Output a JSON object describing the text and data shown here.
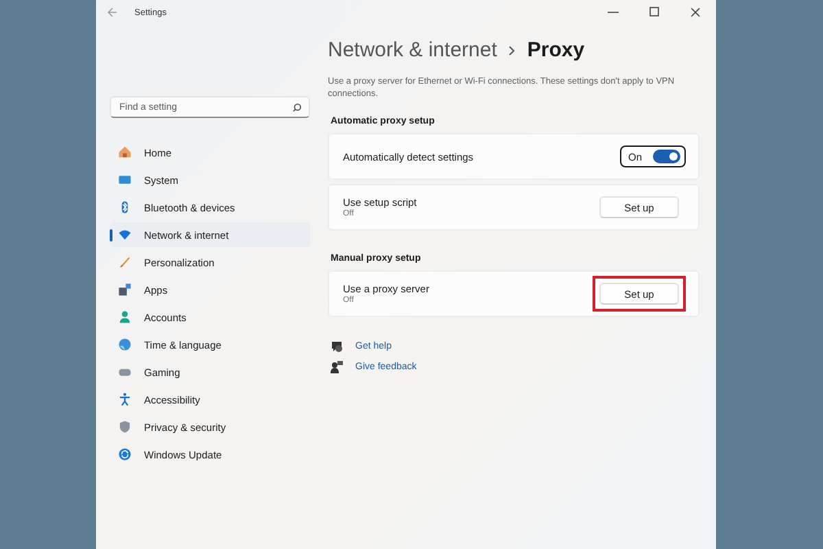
{
  "window": {
    "title": "Settings"
  },
  "search": {
    "placeholder": "Find a setting"
  },
  "nav": [
    {
      "label": "Home",
      "selected": false
    },
    {
      "label": "System",
      "selected": false
    },
    {
      "label": "Bluetooth & devices",
      "selected": false
    },
    {
      "label": "Network & internet",
      "selected": true
    },
    {
      "label": "Personalization",
      "selected": false
    },
    {
      "label": "Apps",
      "selected": false
    },
    {
      "label": "Accounts",
      "selected": false
    },
    {
      "label": "Time & language",
      "selected": false
    },
    {
      "label": "Gaming",
      "selected": false
    },
    {
      "label": "Accessibility",
      "selected": false
    },
    {
      "label": "Privacy & security",
      "selected": false
    },
    {
      "label": "Windows Update",
      "selected": false
    }
  ],
  "breadcrumb": {
    "parent": "Network & internet",
    "current": "Proxy"
  },
  "description": "Use a proxy server for Ethernet or Wi-Fi connections. These settings don't apply to VPN connections.",
  "sections": [
    {
      "title": "Automatic proxy setup",
      "cards": [
        {
          "kind": "toggle",
          "label": "Automatically detect settings",
          "state_label": "On",
          "on": true,
          "focused": true
        },
        {
          "kind": "button",
          "label": "Use setup script",
          "status": "Off",
          "button": "Set up",
          "highlighted": false
        }
      ]
    },
    {
      "title": "Manual proxy setup",
      "cards": [
        {
          "kind": "button",
          "label": "Use a proxy server",
          "status": "Off",
          "button": "Set up",
          "highlighted": true
        }
      ]
    }
  ],
  "links": [
    "Get help",
    "Give feedback"
  ]
}
